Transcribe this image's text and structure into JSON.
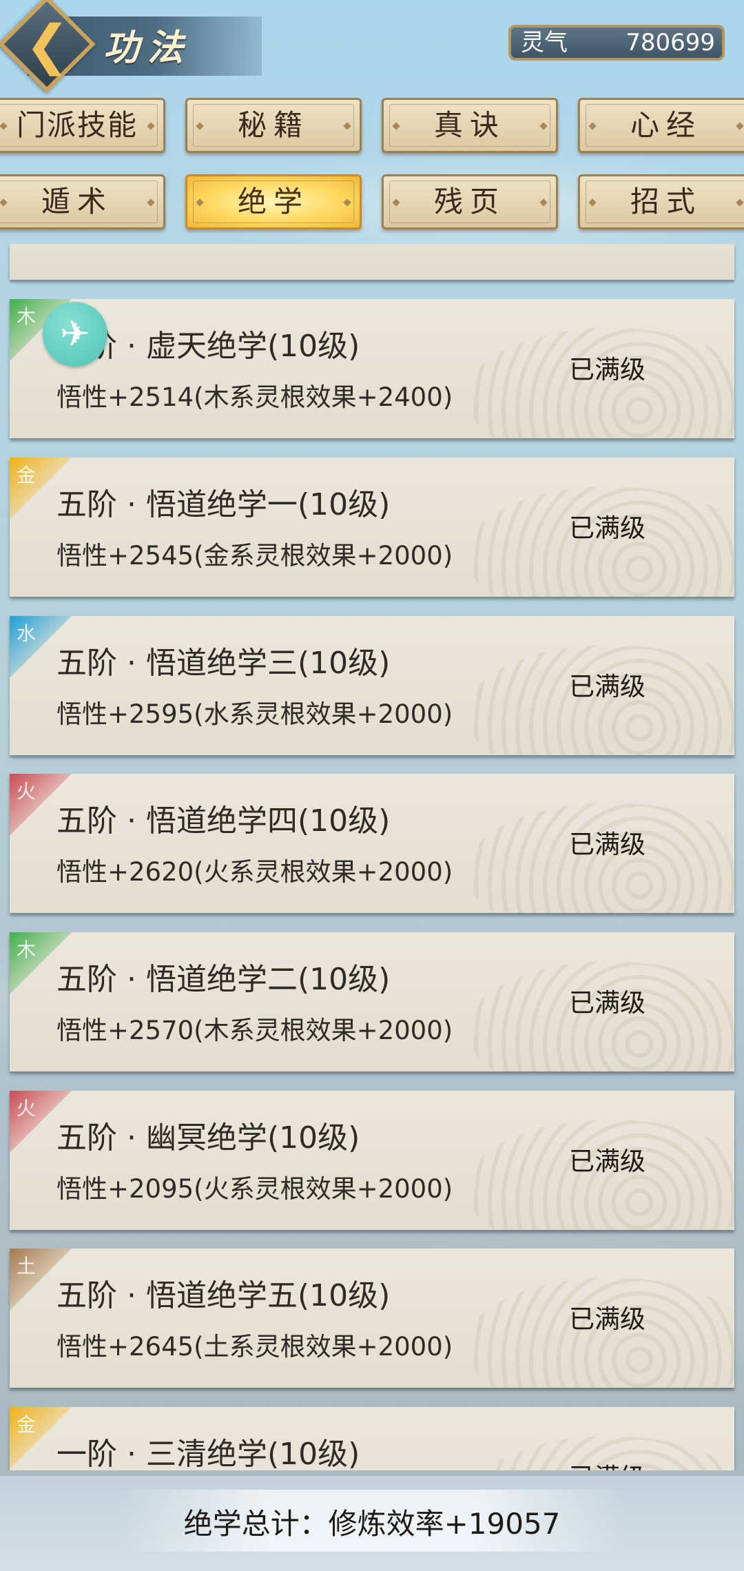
{
  "header": {
    "title": "功法",
    "qi_label": "灵气",
    "qi_value": "780699"
  },
  "tabs": [
    {
      "label": "门派技能",
      "active": false
    },
    {
      "label": "秘籍",
      "active": false
    },
    {
      "label": "真诀",
      "active": false
    },
    {
      "label": "心经",
      "active": false
    },
    {
      "label": "遁术",
      "active": false
    },
    {
      "label": "绝学",
      "active": true
    },
    {
      "label": "残页",
      "active": false
    },
    {
      "label": "招式",
      "active": false
    }
  ],
  "items": [
    {
      "element": "木",
      "element_color": "#3fb04a",
      "name": "五阶 · 虚天绝学(10级)",
      "effect": "悟性+2514(木系灵根效果+2400)",
      "status": "已满级"
    },
    {
      "element": "金",
      "element_color": "#f0b21a",
      "name": "五阶 · 悟道绝学一(10级)",
      "effect": "悟性+2545(金系灵根效果+2000)",
      "status": "已满级"
    },
    {
      "element": "水",
      "element_color": "#1f9ed8",
      "name": "五阶 · 悟道绝学三(10级)",
      "effect": "悟性+2595(水系灵根效果+2000)",
      "status": "已满级"
    },
    {
      "element": "火",
      "element_color": "#cc4a55",
      "name": "五阶 · 悟道绝学四(10级)",
      "effect": "悟性+2620(火系灵根效果+2000)",
      "status": "已满级"
    },
    {
      "element": "木",
      "element_color": "#3fb04a",
      "name": "五阶 · 悟道绝学二(10级)",
      "effect": "悟性+2570(木系灵根效果+2000)",
      "status": "已满级"
    },
    {
      "element": "火",
      "element_color": "#cc4a55",
      "name": "五阶 · 幽冥绝学(10级)",
      "effect": "悟性+2095(火系灵根效果+2000)",
      "status": "已满级"
    },
    {
      "element": "土",
      "element_color": "#a57a4e",
      "name": "五阶 · 悟道绝学五(10级)",
      "effect": "悟性+2645(土系灵根效果+2000)",
      "status": "已满级"
    },
    {
      "element": "金",
      "element_color": "#f0b21a",
      "name": "一阶 · 三清绝学(10级)",
      "effect": "",
      "status": "已满级"
    }
  ],
  "footer": {
    "total": "绝学总计：修炼效率+19057"
  },
  "rocket_icon": "rocket-icon"
}
